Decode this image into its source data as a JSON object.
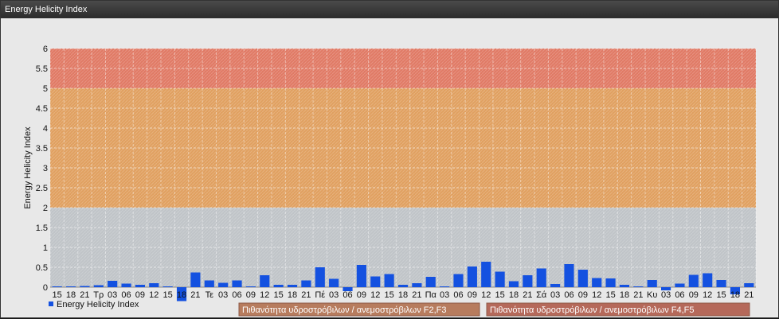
{
  "window": {
    "title": "Energy Helicity Index"
  },
  "chart_data": {
    "type": "bar",
    "ylabel": "Energy Helicity Index",
    "ylim": [
      0,
      6
    ],
    "yticks": [
      0,
      0.5,
      1,
      1.5,
      2,
      2.5,
      3,
      3.5,
      4,
      4.5,
      5,
      5.5,
      6
    ],
    "grid": true,
    "legend_position": "bottom-left",
    "categories": [
      "15",
      "18",
      "21",
      "Τρ",
      "03",
      "06",
      "09",
      "12",
      "15",
      "18",
      "21",
      "Τε",
      "03",
      "06",
      "09",
      "12",
      "15",
      "18",
      "21",
      "Πέ",
      "03",
      "06",
      "09",
      "12",
      "15",
      "18",
      "21",
      "Πα",
      "03",
      "06",
      "09",
      "12",
      "15",
      "18",
      "21",
      "Σά",
      "03",
      "06",
      "09",
      "12",
      "15",
      "18",
      "21",
      "Κυ",
      "03",
      "06",
      "09",
      "12",
      "15",
      "18",
      "21"
    ],
    "series": [
      {
        "name": "Energy Helicity Index",
        "color": "#1451e0",
        "values": [
          0.02,
          0.02,
          0.03,
          0.05,
          0.16,
          0.09,
          0.06,
          0.1,
          0.02,
          -0.35,
          0.37,
          0.17,
          0.11,
          0.17,
          0.02,
          0.3,
          0.06,
          0.06,
          0.17,
          0.5,
          0.21,
          -0.1,
          0.56,
          0.27,
          0.33,
          0.06,
          0.1,
          0.26,
          0.02,
          0.33,
          0.52,
          0.64,
          0.39,
          0.15,
          0.3,
          0.47,
          0.08,
          0.58,
          0.44,
          0.23,
          0.22,
          0.06,
          0.02,
          0.18,
          -0.08,
          0.09,
          0.31,
          0.35,
          0.18,
          -0.18,
          0.1
        ]
      }
    ],
    "bands": [
      {
        "from": 2,
        "to": 5,
        "color": "#e0a060",
        "label": "Πιθανότητα υδροστρόβιλων / ανεμοστρόβιλων F2,F3",
        "legend_color": "#b77c5e"
      },
      {
        "from": 5,
        "to": 6,
        "color": "#e07a65",
        "label": "Πιθανότητα υδροστρόβιλων / ανεμοστρόβιλων F4,F5",
        "legend_color": "#b5695a"
      }
    ]
  }
}
